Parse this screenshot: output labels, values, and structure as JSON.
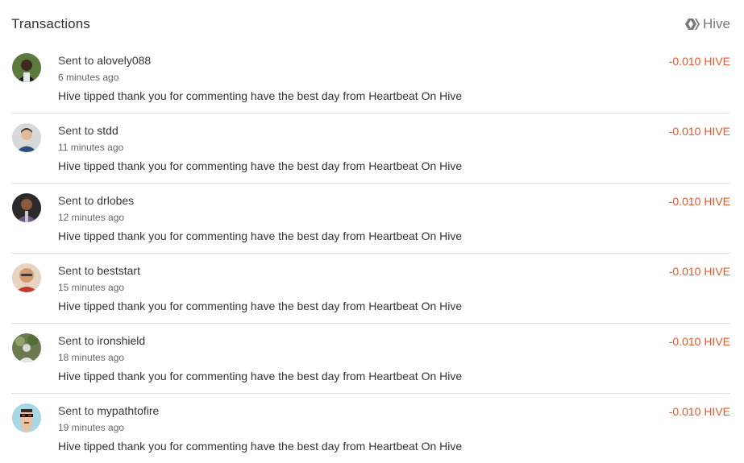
{
  "header": {
    "title": "Transactions",
    "currency_label": "Hive",
    "currency_icon": "hive-logo-icon"
  },
  "colors": {
    "amount_negative": "#e8572a",
    "divider": "#e2e2e2",
    "muted_text": "#666666"
  },
  "transactions": [
    {
      "prefix": "Sent to",
      "user": "alovely088",
      "time": "6 minutes ago",
      "memo": "Hive tipped thank you for commenting have the best day from Heartbeat On Hive",
      "amount": "-0.010 HIVE",
      "avatar_icon": "avatar-photo-icon"
    },
    {
      "prefix": "Sent to",
      "user": "stdd",
      "time": "11 minutes ago",
      "memo": "Hive tipped thank you for commenting have the best day from Heartbeat On Hive",
      "amount": "-0.010 HIVE",
      "avatar_icon": "avatar-photo-icon"
    },
    {
      "prefix": "Sent to",
      "user": "drlobes",
      "time": "12 minutes ago",
      "memo": "Hive tipped thank you for commenting have the best day from Heartbeat On Hive",
      "amount": "-0.010 HIVE",
      "avatar_icon": "avatar-photo-icon"
    },
    {
      "prefix": "Sent to",
      "user": "beststart",
      "time": "15 minutes ago",
      "memo": "Hive tipped thank you for commenting have the best day from Heartbeat On Hive",
      "amount": "-0.010 HIVE",
      "avatar_icon": "avatar-photo-icon"
    },
    {
      "prefix": "Sent to",
      "user": "ironshield",
      "time": "18 minutes ago",
      "memo": "Hive tipped thank you for commenting have the best day from Heartbeat On Hive",
      "amount": "-0.010 HIVE",
      "avatar_icon": "avatar-photo-icon"
    },
    {
      "prefix": "Sent to",
      "user": "mypathtofire",
      "time": "19 minutes ago",
      "memo": "Hive tipped thank you for commenting have the best day from Heartbeat On Hive",
      "amount": "-0.010 HIVE",
      "avatar_icon": "avatar-pixel-art-icon"
    }
  ]
}
